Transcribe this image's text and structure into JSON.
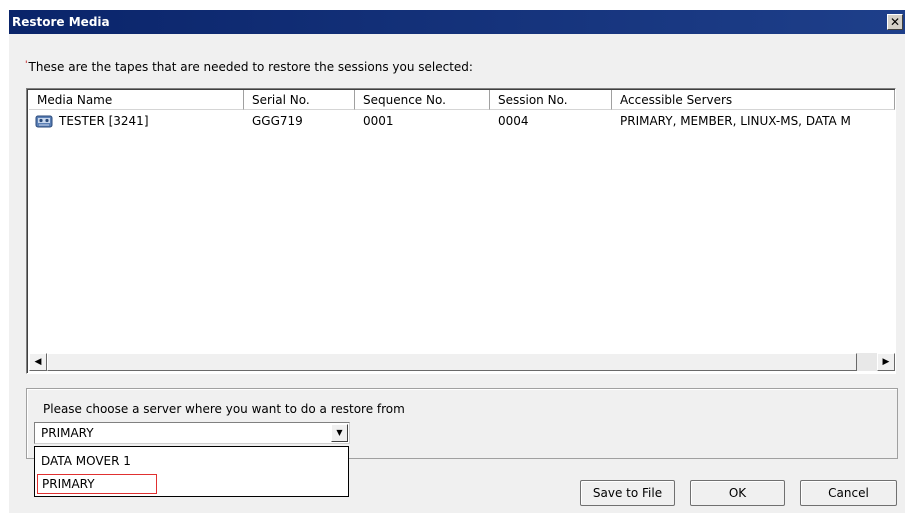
{
  "window": {
    "title": "Restore Media",
    "close_glyph": "✕"
  },
  "intro": {
    "marker": "'",
    "text": "These are the tapes that are needed to restore the sessions you selected:"
  },
  "media_list": {
    "columns": [
      "Media Name",
      "Serial No.",
      "Sequence No.",
      "Session No.",
      "Accessible Servers"
    ],
    "rows": [
      {
        "icon": "tape-icon",
        "media_name": "TESTER [3241]",
        "serial_no": "GGG719",
        "sequence_no": "0001",
        "session_no": "0004",
        "accessible_servers": "PRIMARY, MEMBER, LINUX-MS, DATA M"
      }
    ]
  },
  "server_group": {
    "label": "Please choose a server where you want to do a restore from",
    "selected": "PRIMARY",
    "options": [
      "DATA MOVER 1",
      "PRIMARY"
    ]
  },
  "buttons": {
    "save_to_file": "Save to File",
    "ok": "OK",
    "cancel": "Cancel"
  },
  "colors": {
    "title_bar": "#0a246a",
    "highlight_outline": "#e03030"
  }
}
